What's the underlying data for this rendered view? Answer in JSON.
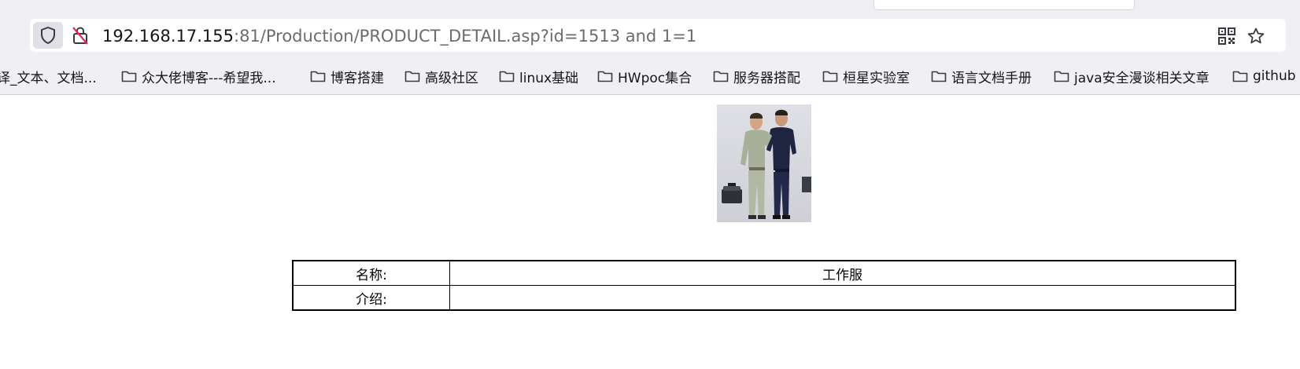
{
  "browser": {
    "url_host": "192.168.17.155",
    "url_rest": ":81/Production/PRODUCT_DETAIL.asp?id=1513 and 1=1",
    "icons": {
      "shield": "shield-icon",
      "insecure_lock": "insecure-lock-icon",
      "qr": "qr-code-icon",
      "bookmark_star": "star-icon"
    }
  },
  "bookmarks": [
    {
      "label": "译_文本、文档..."
    },
    {
      "label": "众大佬博客---希望我..."
    },
    {
      "label": "博客搭建"
    },
    {
      "label": "高级社区"
    },
    {
      "label": "linux基础"
    },
    {
      "label": "HWpoc集合"
    },
    {
      "label": "服务器搭配"
    },
    {
      "label": "桓星实验室"
    },
    {
      "label": "语言文档手册"
    },
    {
      "label": "java安全漫谈相关文章"
    },
    {
      "label": "github"
    }
  ],
  "product": {
    "name_label": "名称:",
    "name_value": "工作服",
    "intro_label": "介绍:",
    "intro_value": ""
  },
  "colors": {
    "chrome_bg": "#f0f0f4",
    "url_host": "#15141a",
    "url_rest": "#6b6b72",
    "insecure_red": "#e22850"
  }
}
